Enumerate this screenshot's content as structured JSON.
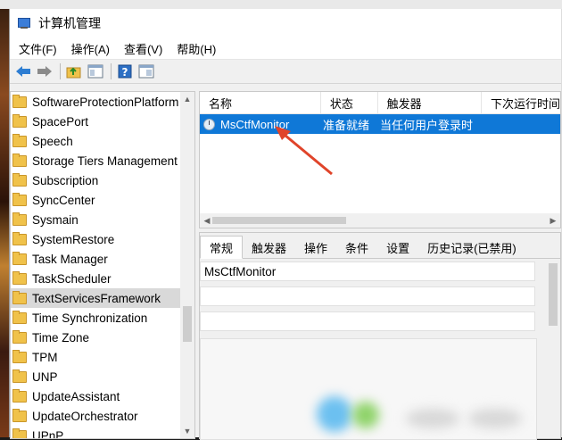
{
  "window": {
    "title": "计算机管理"
  },
  "menubar": {
    "items": [
      "文件(F)",
      "操作(A)",
      "查看(V)",
      "帮助(H)"
    ]
  },
  "toolbar": {
    "buttons": [
      "back-arrow-icon",
      "forward-arrow-icon",
      "up-folder-icon",
      "show-hide-tree-icon",
      "help-icon",
      "properties-icon"
    ]
  },
  "tree": {
    "items": [
      "SoftwareProtectionPlatform",
      "SpacePort",
      "Speech",
      "Storage Tiers Management",
      "Subscription",
      "SyncCenter",
      "Sysmain",
      "SystemRestore",
      "Task Manager",
      "TaskScheduler",
      "TextServicesFramework",
      "Time Synchronization",
      "Time Zone",
      "TPM",
      "UNP",
      "UpdateAssistant",
      "UpdateOrchestrator",
      "UPnP"
    ],
    "selected": "TextServicesFramework"
  },
  "task_list": {
    "columns": [
      "名称",
      "状态",
      "触发器",
      "下次运行时间"
    ],
    "rows": [
      {
        "name": "MsCtfMonitor",
        "status": "准备就绪",
        "trigger": "当任何用户登录时",
        "next_run": ""
      }
    ]
  },
  "detail": {
    "tabs": [
      "常规",
      "触发器",
      "操作",
      "条件",
      "设置",
      "历史记录(已禁用)"
    ],
    "active_tab": "常规",
    "name_value": "MsCtfMonitor"
  },
  "colors": {
    "selection": "#0f78d7",
    "annotation_arrow": "#e0442a"
  }
}
